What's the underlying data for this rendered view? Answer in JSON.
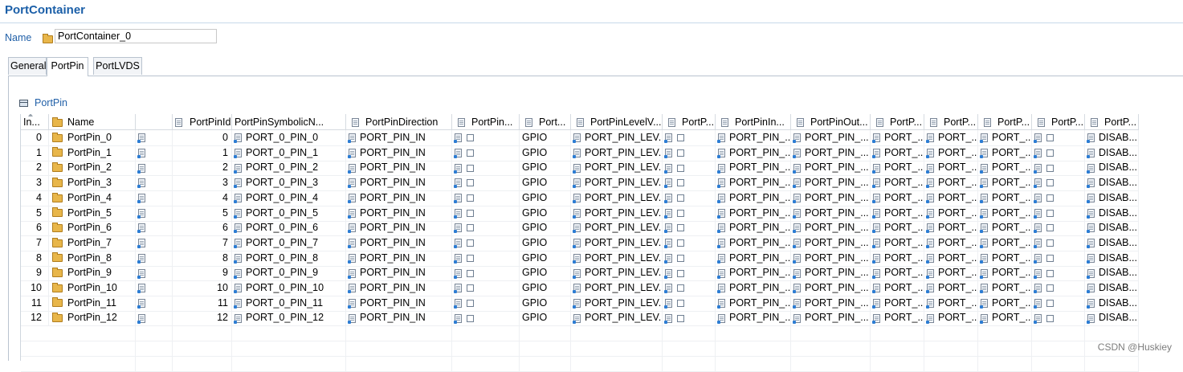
{
  "header": {
    "title": "PortContainer"
  },
  "name_field": {
    "label": "Name",
    "value": "PortContainer_0"
  },
  "tabs": [
    {
      "label": "General",
      "active": false
    },
    {
      "label": "PortPin",
      "active": true
    },
    {
      "label": "PortLVDS",
      "active": false
    }
  ],
  "section": {
    "title": "PortPin"
  },
  "columns": [
    "In...",
    "Name",
    "",
    "PortPinId",
    "PortPinSymbolicN...",
    "PortPinDirection",
    "PortPin...",
    "Port...",
    "PortPinLevelV...",
    "PortP...",
    "PortPinIn...",
    "PortPinOut...",
    "PortP...",
    "PortP...",
    "PortP...",
    "PortP...",
    "PortP..."
  ],
  "rows": [
    {
      "idx": "0",
      "name": "PortPin_0",
      "id": "0",
      "sym": "PORT_0_PIN_0"
    },
    {
      "idx": "1",
      "name": "PortPin_1",
      "id": "1",
      "sym": "PORT_0_PIN_1"
    },
    {
      "idx": "2",
      "name": "PortPin_2",
      "id": "2",
      "sym": "PORT_0_PIN_2"
    },
    {
      "idx": "3",
      "name": "PortPin_3",
      "id": "3",
      "sym": "PORT_0_PIN_3"
    },
    {
      "idx": "4",
      "name": "PortPin_4",
      "id": "4",
      "sym": "PORT_0_PIN_4"
    },
    {
      "idx": "5",
      "name": "PortPin_5",
      "id": "5",
      "sym": "PORT_0_PIN_5"
    },
    {
      "idx": "6",
      "name": "PortPin_6",
      "id": "6",
      "sym": "PORT_0_PIN_6"
    },
    {
      "idx": "7",
      "name": "PortPin_7",
      "id": "7",
      "sym": "PORT_0_PIN_7"
    },
    {
      "idx": "8",
      "name": "PortPin_8",
      "id": "8",
      "sym": "PORT_0_PIN_8"
    },
    {
      "idx": "9",
      "name": "PortPin_9",
      "id": "9",
      "sym": "PORT_0_PIN_9"
    },
    {
      "idx": "10",
      "name": "PortPin_10",
      "id": "10",
      "sym": "PORT_0_PIN_10"
    },
    {
      "idx": "11",
      "name": "PortPin_11",
      "id": "11",
      "sym": "PORT_0_PIN_11"
    },
    {
      "idx": "12",
      "name": "PortPin_12",
      "id": "12",
      "sym": "PORT_0_PIN_12"
    }
  ],
  "row_values": {
    "direction": "PORT_PIN_IN",
    "mode": "GPIO",
    "level": "PORT_PIN_LEV...",
    "in": "PORT_PIN_...",
    "out": "PORT_PIN_...",
    "p1": "PORT_...",
    "p2": "PORT_...",
    "p3": "PORT_...",
    "last": "DISAB..."
  },
  "watermark": "CSDN @Huskiey"
}
